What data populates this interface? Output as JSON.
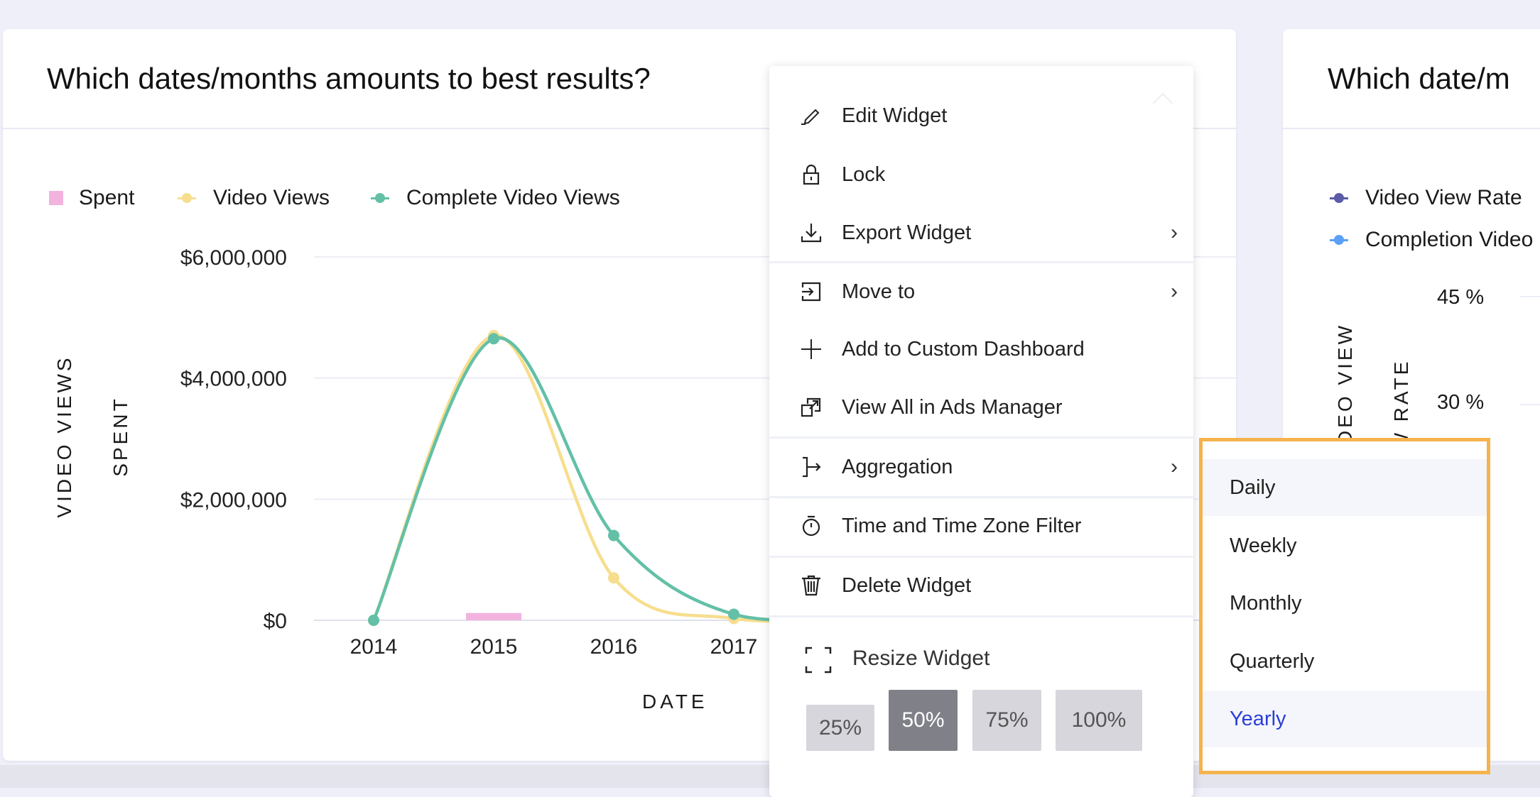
{
  "widget_left": {
    "title": "Which dates/months amounts to best results?",
    "legend": [
      {
        "label": "Spent",
        "color": "#f2b3df",
        "shape": "square"
      },
      {
        "label": "Video Views",
        "color": "#f7de8e",
        "shape": "dot-line"
      },
      {
        "label": "Complete Video Views",
        "color": "#63c0a6",
        "shape": "dot-line"
      }
    ],
    "y_axis_titles": [
      "VIDEO VIEWS",
      "SPENT"
    ],
    "x_axis_title": "DATE"
  },
  "chart_data": {
    "type": "line",
    "x": [
      "2014",
      "2015",
      "2016",
      "2017"
    ],
    "ytick_labels": [
      "$0",
      "$2,000,000",
      "$4,000,000",
      "$6,000,000"
    ],
    "yticks": [
      0,
      2000000,
      4000000,
      6000000
    ],
    "ylim": [
      0,
      6000000
    ],
    "xlabel": "DATE",
    "ylabel": "VIDEO VIEWS / SPENT",
    "grid": true,
    "legend_placement": "top-left",
    "series": [
      {
        "name": "Spent",
        "type": "bar",
        "color": "#f2b3df",
        "values": [
          0,
          120000,
          0,
          0
        ]
      },
      {
        "name": "Video Views",
        "type": "line",
        "color": "#f7de8e",
        "values": [
          0,
          4700000,
          700000,
          30000
        ]
      },
      {
        "name": "Complete Video Views",
        "type": "line",
        "color": "#63c0a6",
        "values": [
          0,
          4650000,
          1400000,
          100000
        ]
      }
    ]
  },
  "widget_right": {
    "title": "Which date/m",
    "legend": [
      {
        "label": "Video View Rate",
        "color": "#5b5ba6"
      },
      {
        "label": "Completion Video",
        "color": "#5aa0f5"
      }
    ],
    "y_axis_titles": [
      "DEO VIEW",
      "W RATE"
    ],
    "ytick_labels": [
      "45 %",
      "30 %"
    ]
  },
  "context_menu": {
    "items": [
      {
        "label": "Edit Widget",
        "icon": "pencil-icon"
      },
      {
        "label": "Lock",
        "icon": "lock-icon"
      },
      {
        "label": "Export Widget",
        "icon": "download-icon",
        "submenu": true
      },
      {
        "label": "Move to",
        "icon": "move-to-icon",
        "submenu": true
      },
      {
        "label": "Add to Custom Dashboard",
        "icon": "plus-icon"
      },
      {
        "label": "View All in Ads Manager",
        "icon": "external-link-icon"
      },
      {
        "label": "Aggregation",
        "icon": "aggregation-icon",
        "submenu": true
      },
      {
        "label": "Time and Time Zone Filter",
        "icon": "stopwatch-icon"
      },
      {
        "label": "Delete Widget",
        "icon": "trash-icon"
      }
    ],
    "resize": {
      "label": "Resize Widget",
      "options": [
        "25%",
        "50%",
        "75%",
        "100%"
      ],
      "selected": "50%"
    }
  },
  "aggregation_submenu": {
    "options": [
      "Daily",
      "Weekly",
      "Monthly",
      "Quarterly",
      "Yearly"
    ],
    "selected": "Yearly",
    "hovered": "Daily",
    "highlight_border_color": "#f4b34d",
    "selected_color": "#2b3fd6"
  }
}
